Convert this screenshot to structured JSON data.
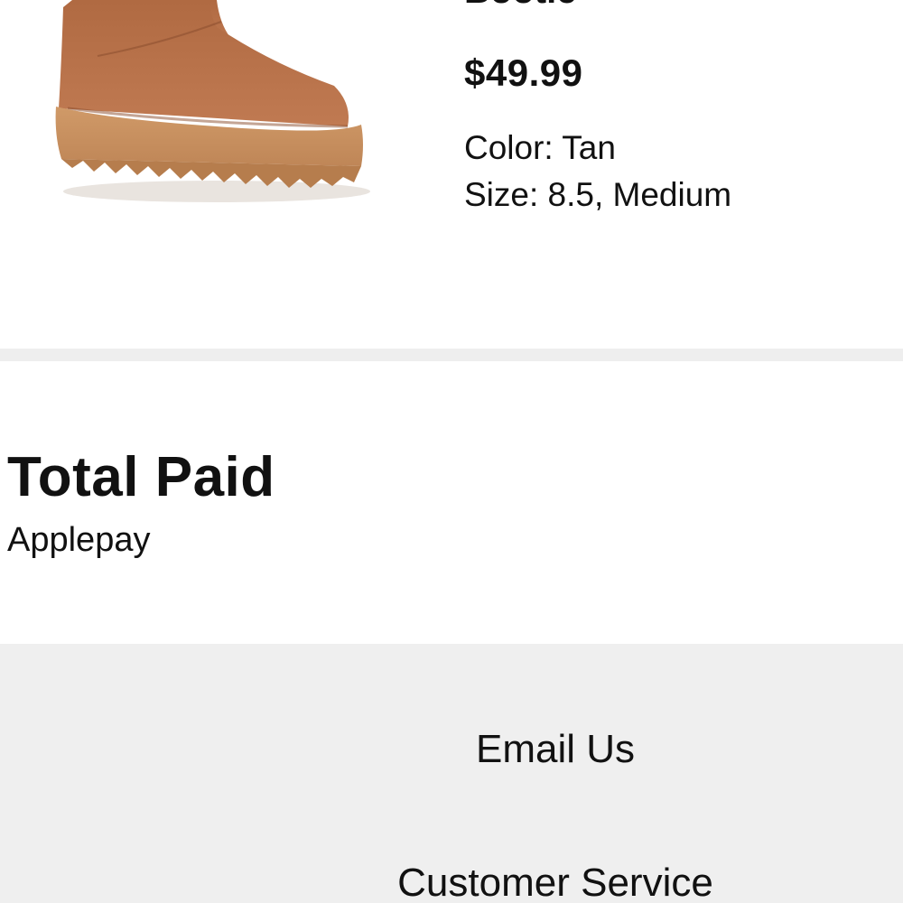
{
  "product": {
    "name": "Bootie",
    "price": "$49.99",
    "color": "Color: Tan",
    "size": "Size: 8.5, Medium",
    "image_icon": "tan-suede-platform-boot"
  },
  "total": {
    "title": "Total Paid",
    "payment_method": "Applepay"
  },
  "footer": {
    "links": [
      {
        "label": "Email Us"
      },
      {
        "label": "Customer Service"
      }
    ]
  },
  "colors": {
    "divider": "#eeeeee",
    "footer_bg": "#efefef",
    "boot": "#b8724a",
    "sole": "#c78f5e"
  }
}
